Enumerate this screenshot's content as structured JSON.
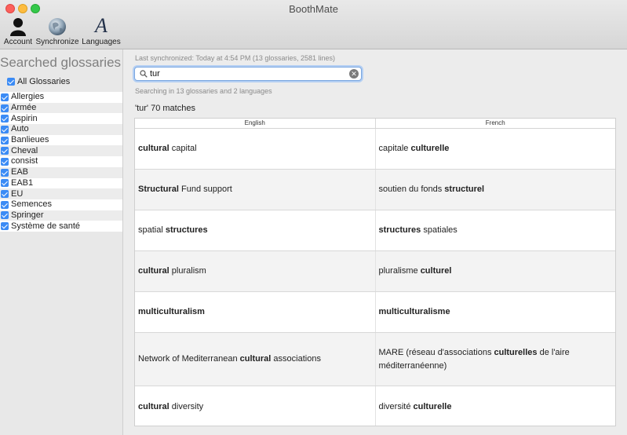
{
  "window": {
    "title": "BoothMate"
  },
  "toolbar": {
    "account": "Account",
    "synchronize": "Synchronize",
    "languages": "Languages"
  },
  "sidebar": {
    "title": "Searched glossaries",
    "all_label": "All Glossaries",
    "items": [
      "Allergies",
      "Armée",
      "Aspirin",
      "Auto",
      "Banlieues",
      "Cheval",
      "consist",
      "EAB",
      "EAB1",
      "EU",
      "Semences",
      "Springer",
      "Système de santé"
    ]
  },
  "main": {
    "last_sync": "Last synchronized: Today at 4:54 PM (13 glossaries, 2581 lines)",
    "search_value": "tur",
    "searching_in": "Searching in 13 glossaries and 2 languages",
    "match_count": "'tur' 70 matches",
    "columns": [
      "English",
      "French"
    ],
    "rows": [
      {
        "en": [
          [
            "cultural",
            true
          ],
          [
            " capital",
            false
          ]
        ],
        "fr": [
          [
            "capitale ",
            false
          ],
          [
            "culturelle",
            true
          ]
        ]
      },
      {
        "en": [
          [
            "Structural",
            true
          ],
          [
            " Fund support",
            false
          ]
        ],
        "fr": [
          [
            "soutien du fonds ",
            false
          ],
          [
            "structurel",
            true
          ]
        ]
      },
      {
        "en": [
          [
            "spatial ",
            false
          ],
          [
            "structures",
            true
          ]
        ],
        "fr": [
          [
            "structures",
            true
          ],
          [
            " spatiales",
            false
          ]
        ]
      },
      {
        "en": [
          [
            "cultural",
            true
          ],
          [
            " pluralism",
            false
          ]
        ],
        "fr": [
          [
            "pluralisme ",
            false
          ],
          [
            "culturel",
            true
          ]
        ]
      },
      {
        "en": [
          [
            "multiculturalism",
            true
          ]
        ],
        "fr": [
          [
            "multiculturalisme",
            true
          ]
        ]
      },
      {
        "en": [
          [
            "Network of Mediterranean ",
            false
          ],
          [
            "cultural",
            true
          ],
          [
            " associations",
            false
          ]
        ],
        "fr": [
          [
            "MARE (réseau d'associations ",
            false
          ],
          [
            "culturelles",
            true
          ],
          [
            " de l'aire méditerranéenne)",
            false
          ]
        ]
      },
      {
        "en": [
          [
            "cultural",
            true
          ],
          [
            " diversity",
            false
          ]
        ],
        "fr": [
          [
            "diversité ",
            false
          ],
          [
            "culturelle",
            true
          ]
        ]
      }
    ]
  },
  "colors": {
    "accent": "#3b8bf5",
    "search_focus": "#7ba7e0"
  }
}
